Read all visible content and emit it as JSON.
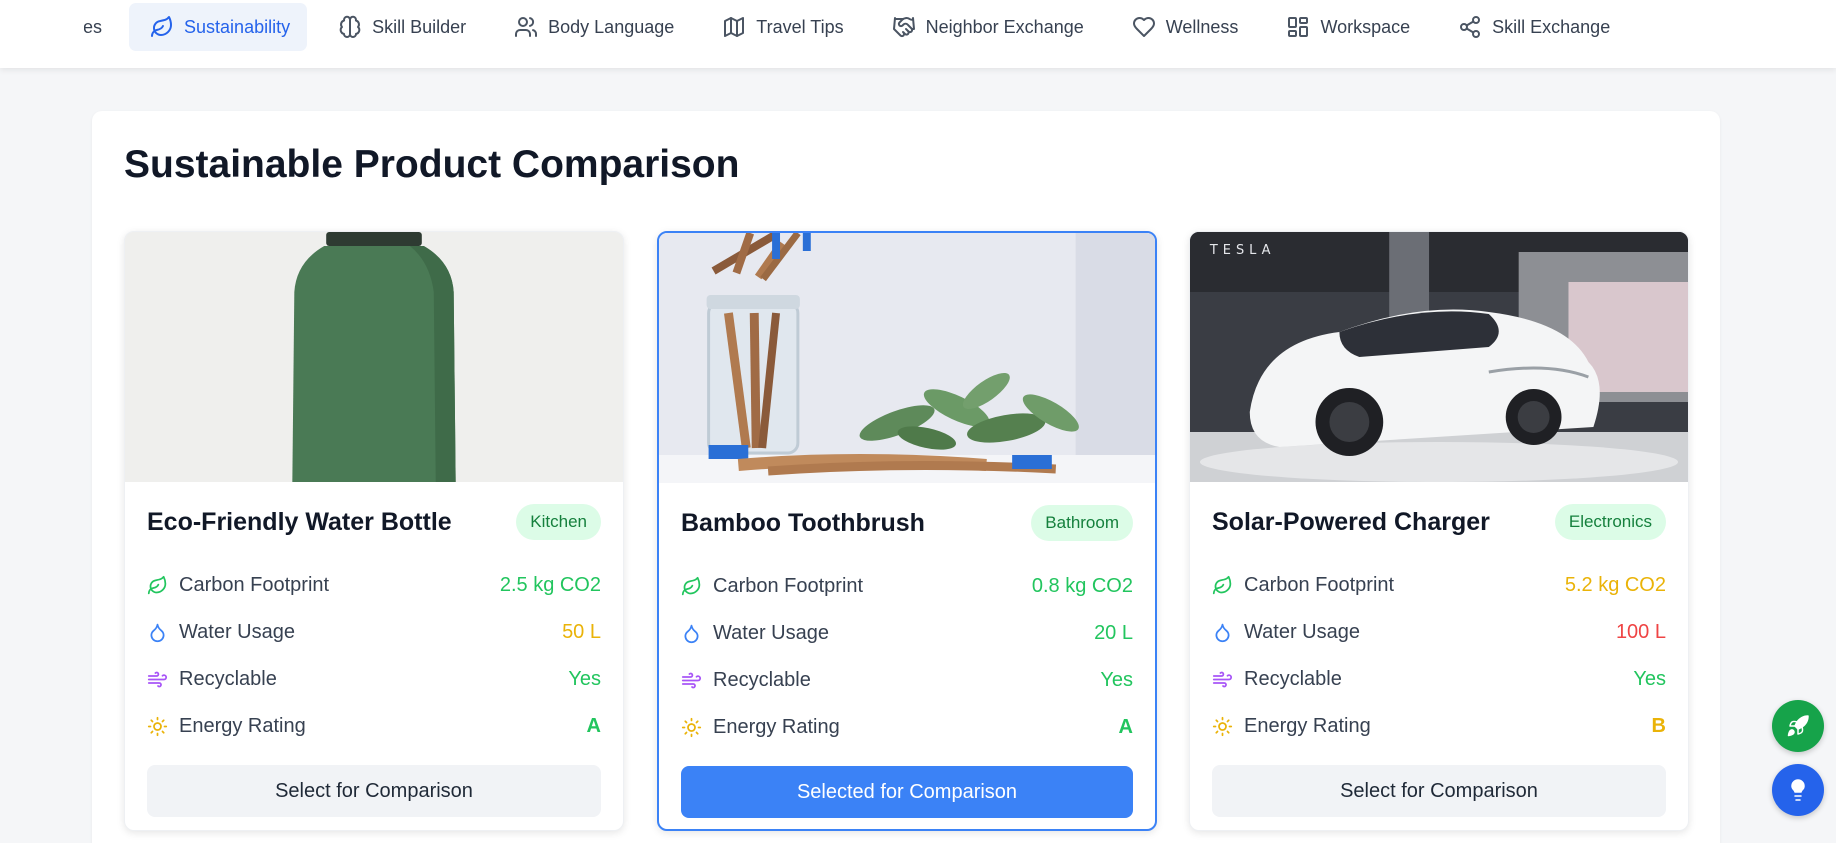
{
  "nav": {
    "items": [
      {
        "label": "cipes",
        "icon": "none"
      },
      {
        "label": "Sustainability",
        "icon": "leaf-icon"
      },
      {
        "label": "Skill Builder",
        "icon": "brain-icon"
      },
      {
        "label": "Body Language",
        "icon": "users-icon"
      },
      {
        "label": "Travel Tips",
        "icon": "map-icon"
      },
      {
        "label": "Neighbor Exchange",
        "icon": "handshake-icon"
      },
      {
        "label": "Wellness",
        "icon": "heart-icon"
      },
      {
        "label": "Workspace",
        "icon": "layout-icon"
      },
      {
        "label": "Skill Exchange",
        "icon": "share-icon"
      }
    ],
    "active": "Sustainability"
  },
  "page": {
    "title": "Sustainable Product Comparison"
  },
  "products": [
    {
      "name": "Eco-Friendly Water Bottle",
      "category": "Kitchen",
      "carbon_label": "Carbon Footprint",
      "carbon_value": "2.5 kg CO2",
      "water_label": "Water Usage",
      "water_value": "50 L",
      "recyclable_label": "Recyclable",
      "recyclable_value": "Yes",
      "energy_label": "Energy Rating",
      "energy_value": "A",
      "button": "Select for Comparison",
      "selected": false
    },
    {
      "name": "Bamboo Toothbrush",
      "category": "Bathroom",
      "carbon_label": "Carbon Footprint",
      "carbon_value": "0.8 kg CO2",
      "water_label": "Water Usage",
      "water_value": "20 L",
      "recyclable_label": "Recyclable",
      "recyclable_value": "Yes",
      "energy_label": "Energy Rating",
      "energy_value": "A",
      "button": "Selected for Comparison",
      "selected": true
    },
    {
      "name": "Solar-Powered Charger",
      "category": "Electronics",
      "carbon_label": "Carbon Footprint",
      "carbon_value": "5.2 kg CO2",
      "water_label": "Water Usage",
      "water_value": "100 L",
      "recyclable_label": "Recyclable",
      "recyclable_value": "Yes",
      "energy_label": "Energy Rating",
      "energy_value": "B",
      "button": "Select for Comparison",
      "selected": false
    }
  ],
  "image_text": {
    "car_brand": "TESLA"
  },
  "colors": {
    "accent": "#3b82f6",
    "good": "#22c55e",
    "warn": "#eab308",
    "bad": "#ef4444",
    "fab_green": "#16a34a",
    "fab_blue": "#2563eb"
  },
  "fabs": [
    {
      "icon": "rocket-icon"
    },
    {
      "icon": "lightbulb-icon"
    }
  ]
}
